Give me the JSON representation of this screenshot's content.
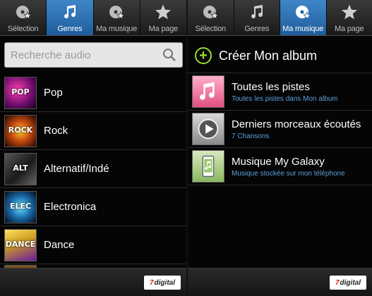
{
  "left_panel": {
    "tabs": [
      {
        "label": "Sélection",
        "icon": "disc-star-icon",
        "active": false
      },
      {
        "label": "Genres",
        "icon": "music-note-icon",
        "active": true
      },
      {
        "label": "Ma musique",
        "icon": "disc-star-icon",
        "active": false
      },
      {
        "label": "Ma page",
        "icon": "star-icon",
        "active": false
      }
    ],
    "search": {
      "placeholder": "Recherche audio"
    },
    "genres": [
      {
        "label": "Pop",
        "art_text": "POP",
        "color": "#c8288a"
      },
      {
        "label": "Rock",
        "art_text": "ROCK",
        "color": "#c84a10"
      },
      {
        "label": "Alternatif/Indé",
        "art_text": "ALT",
        "color": "#333333"
      },
      {
        "label": "Electronica",
        "art_text": "ELEC",
        "color": "#2a8fd8"
      },
      {
        "label": "Dance",
        "art_text": "DANCE",
        "color": "#d0a020"
      }
    ],
    "badge": {
      "seven": "7",
      "digital": "digital"
    }
  },
  "right_panel": {
    "tabs": [
      {
        "label": "Sélection",
        "icon": "disc-star-icon",
        "active": false
      },
      {
        "label": "Genres",
        "icon": "music-note-icon",
        "active": false
      },
      {
        "label": "Ma musique",
        "icon": "disc-star-icon",
        "active": true
      },
      {
        "label": "Ma page",
        "icon": "star-icon",
        "active": false
      }
    ],
    "create_album_label": "Créer Mon album",
    "albums": [
      {
        "title": "Toutes les pistes",
        "subtitle": "Toutes les pistes dans Mon album",
        "icon": "music-notes-icon"
      },
      {
        "title": "Derniers morceaux écoutés",
        "subtitle": "7 Chansons",
        "icon": "play-icon"
      },
      {
        "title": "Musique My Galaxy",
        "subtitle": "Musique stockée sur mon téléphone",
        "icon": "phone-icon"
      }
    ],
    "badge": {
      "seven": "7",
      "digital": "digital"
    }
  },
  "colors": {
    "active_tab": "#2f74b6",
    "subtitle_blue": "#5aa0dc",
    "plus_green": "#9adb2f"
  }
}
